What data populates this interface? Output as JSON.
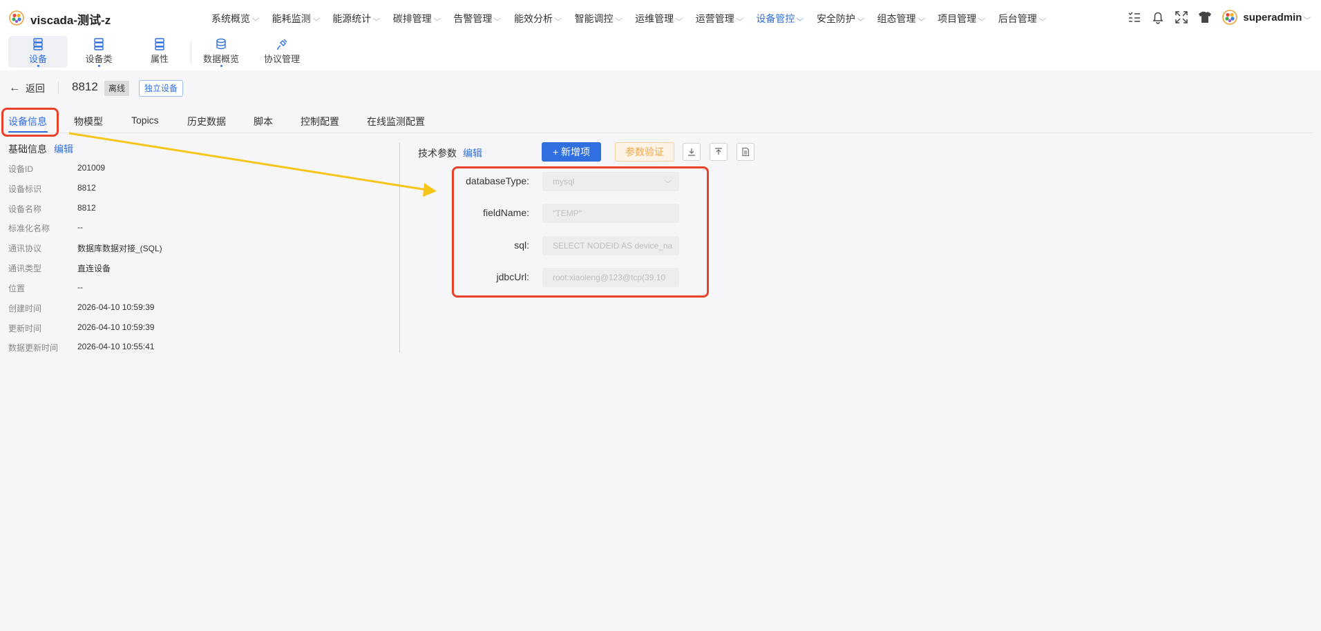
{
  "app": {
    "title": "viscada-测试-z"
  },
  "menu": [
    {
      "label": "系统概览"
    },
    {
      "label": "能耗监测"
    },
    {
      "label": "能源统计"
    },
    {
      "label": "碳排管理"
    },
    {
      "label": "告警管理"
    },
    {
      "label": "能效分析"
    },
    {
      "label": "智能调控"
    },
    {
      "label": "运维管理"
    },
    {
      "label": "运营管理"
    },
    {
      "label": "设备管控"
    },
    {
      "label": "安全防护"
    },
    {
      "label": "组态管理"
    },
    {
      "label": "项目管理"
    },
    {
      "label": "后台管理"
    }
  ],
  "menu_active": "设备管控",
  "user": {
    "name": "superadmin"
  },
  "subtabs": [
    {
      "label": "设备"
    },
    {
      "label": "设备类"
    },
    {
      "label": "属性"
    },
    {
      "label": "数据概览"
    },
    {
      "label": "协议管理"
    }
  ],
  "header": {
    "back_label": "返回",
    "device_id": "8812",
    "status_badge": "离线",
    "type_badge": "独立设备"
  },
  "tabs": [
    {
      "label": "设备信息"
    },
    {
      "label": "物模型"
    },
    {
      "label": "Topics"
    },
    {
      "label": "历史数据"
    },
    {
      "label": "脚本"
    },
    {
      "label": "控制配置"
    },
    {
      "label": "在线监测配置"
    }
  ],
  "basic_info": {
    "title": "基础信息",
    "edit_label": "编辑",
    "rows": [
      {
        "key": "设备ID",
        "value": "201009"
      },
      {
        "key": "设备标识",
        "value": "8812"
      },
      {
        "key": "设备名称",
        "value": "8812"
      },
      {
        "key": "标准化名称",
        "value": "--"
      },
      {
        "key": "通讯协议",
        "value": "数据库数据对接_(SQL)"
      },
      {
        "key": "通讯类型",
        "value": "直连设备"
      },
      {
        "key": "位置",
        "value": "--"
      },
      {
        "key": "创建时间",
        "value": "2026-04-10 10:59:39"
      },
      {
        "key": "更新时间",
        "value": "2026-04-10 10:59:39"
      },
      {
        "key": "数据更新时间",
        "value": "2026-04-10 10:55:41"
      }
    ]
  },
  "tech_params": {
    "title": "技术参数",
    "edit_label": "编辑",
    "add_label": "+ 新增项",
    "verify_label": "参数验证",
    "fields": [
      {
        "label": "databaseType:",
        "value": "mysql"
      },
      {
        "label": "fieldName:",
        "value": "\"TEMP\""
      },
      {
        "label": "sql:",
        "value": "SELECT NODEID AS device_na"
      },
      {
        "label": "jdbcUrl:",
        "value": "root:xiaoleng@123@tcp(39.10"
      }
    ]
  },
  "colors": {
    "accent": "#2f6fe0",
    "annotation_box": "#e8412b",
    "annotation_arrow": "#f5c518",
    "verify_text": "#f0a64b"
  }
}
